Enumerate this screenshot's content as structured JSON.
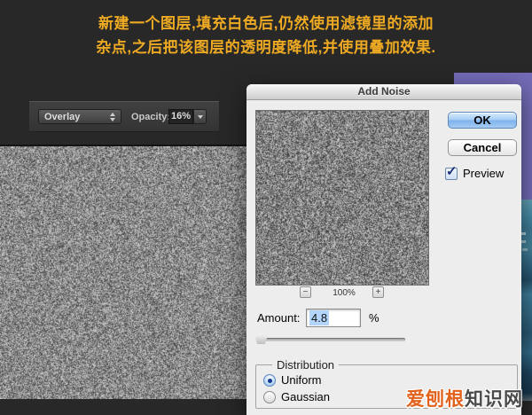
{
  "tutorial_note": {
    "line1": "新建一个图层,填充白色后,仍然使用滤镜里的添加",
    "line2": "杂点,之后把该图层的透明度降低,并使用叠加效果.",
    "text_color": "#eeaa22"
  },
  "layers_toolbar": {
    "blend_mode": "Overlay",
    "opacity_label": "Opacity:",
    "opacity_value": "16%"
  },
  "dialog": {
    "title": "Add Noise",
    "ok_label": "OK",
    "cancel_label": "Cancel",
    "preview_label": "Preview",
    "preview_checked": true,
    "zoom": {
      "minus": "−",
      "value": "100%",
      "plus": "+"
    },
    "amount_label": "Amount:",
    "amount_value": "4.8",
    "percent_sign": "%",
    "distribution": {
      "legend": "Distribution",
      "options": [
        {
          "label": "Uniform",
          "selected": true
        },
        {
          "label": "Gaussian",
          "selected": false
        }
      ]
    }
  },
  "watermark": {
    "highlight": "爱刨根",
    "rest": "知识网"
  },
  "icons": {
    "check": "✓",
    "updown_arrows": "stacked-triangles",
    "dropdown_arrow": "triangle-down"
  },
  "colors": {
    "background_dark": "#282828",
    "note_yellow": "#eeaa22",
    "purple_block": "#746cb8",
    "ok_button_blue": "#8fc0f0",
    "selection_blue": "#b4d5fb",
    "watermark_orange": "#e2611c",
    "watermark_gray": "#4a4a4a"
  }
}
